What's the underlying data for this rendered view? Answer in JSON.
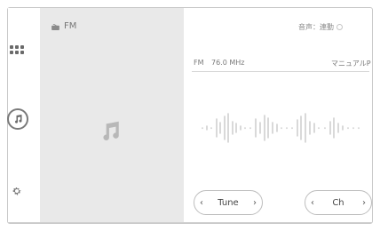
{
  "source": {
    "label": "FM"
  },
  "status": {
    "volume_mode": "音声：連動"
  },
  "station": {
    "band": "FM",
    "frequency": "76.0 MHz",
    "mode": "マニュアルP"
  },
  "controls": {
    "tune": {
      "label": "Tune",
      "prev": "‹",
      "next": "›"
    },
    "channel": {
      "label": "Ch",
      "prev": "‹",
      "next": "›"
    }
  },
  "icons": {
    "apps": "grid-icon",
    "media": "music-note-icon",
    "settings": "gear-icon",
    "radio": "radio-icon"
  }
}
